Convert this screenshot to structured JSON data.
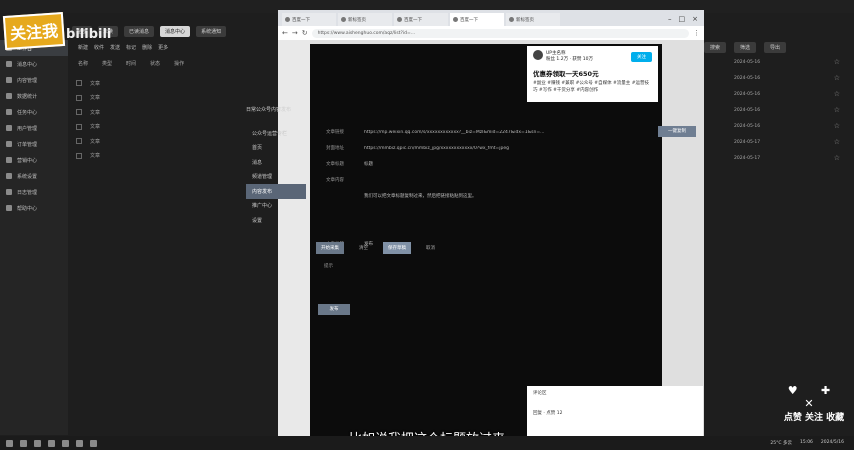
{
  "watermark": {
    "main": "关注我",
    "sub": "bilibili"
  },
  "top_buttons": [
    "全部",
    "未读",
    "已读消息",
    "消息中心",
    "系统通知"
  ],
  "toolbar": [
    "新建",
    "收件",
    "发送",
    "标记",
    "删除",
    "更多"
  ],
  "filters": [
    "名称",
    "类型",
    "时间",
    "状态",
    "操作"
  ],
  "list_rows": [
    "文章",
    "文章",
    "文章",
    "文章",
    "文章",
    "文章"
  ],
  "sidebar": [
    {
      "label": "工作台"
    },
    {
      "label": "消息中心"
    },
    {
      "label": "内容管理"
    },
    {
      "label": "数据统计"
    },
    {
      "label": "任务中心"
    },
    {
      "label": "用户管理"
    },
    {
      "label": "订单管理"
    },
    {
      "label": "营销中心"
    },
    {
      "label": "系统设置"
    },
    {
      "label": "日志管理"
    },
    {
      "label": "帮助中心"
    }
  ],
  "right_panel": {
    "buttons": [
      "搜索",
      "筛选",
      "导出"
    ],
    "rows": [
      "2024-05-16",
      "2024-05-16",
      "2024-05-16",
      "2024-05-16",
      "2024-05-16",
      "2024-05-17",
      "2024-05-17"
    ]
  },
  "browser": {
    "tabs": [
      "百度一下",
      "新标签页",
      "百度一下",
      "百度一下",
      "新标签页"
    ],
    "url": "https://www.aishenghuo.com/aqz/list?id=..."
  },
  "site": {
    "title": "日常公众号内容发布",
    "nav": [
      "公众号运营专栏",
      "首页",
      "消息",
      "频道管理",
      "内容发布",
      "推广中心",
      "设置"
    ],
    "active_nav": 4
  },
  "form": {
    "rows": [
      {
        "label": "文章链接",
        "value": "https://mp.weixin.qq.com/s/xxxxxxxxxxxx?__biz=MzI&mid=2247&idx=1&sn=..."
      },
      {
        "label": "封面地址",
        "value": "https://mmbiz.qpic.cn/mmbiz_jpg/xxxxxxxxxxxx/0?wx_fmt=jpeg"
      },
      {
        "label": "文章标题",
        "value": "标题"
      },
      {
        "label": "文章内容",
        "value": ""
      },
      {
        "label": "",
        "value": "我们可以把文章标题复制过来，然后把链接粘贴到这里。"
      },
      {
        "label": "",
        "value": ""
      },
      {
        "label": "",
        "value": ""
      },
      {
        "label": "文章标签",
        "value": "发布"
      }
    ],
    "copy_button": "一键复制",
    "buttons": {
      "primary": "开始采集",
      "plain": "清空",
      "secondary": "保存草稿",
      "plain2": "取消"
    },
    "small_text": "提示",
    "publish_button": "发布"
  },
  "card": {
    "name": "UP主名称",
    "meta": "粉丝 1.2万 · 获赞 10万",
    "follow": "关注",
    "headline": "优惠券领取一天650元",
    "tags": "#副业 #赚钱 #兼职 #公众号 #自媒体 #流量主 #运营技巧 #写作 #干货分享 #内容创作"
  },
  "card2": {
    "line1": "评论区",
    "line2": "回复 · 点赞 12"
  },
  "sticker": {
    "icons": "♥ ✚ ✕",
    "text": "点赞 关注 收藏"
  },
  "subtitle": "比如说我把这个标题放过来",
  "tray": {
    "weather": "25°C 多云",
    "time": "15:06",
    "date": "2024/5/16"
  }
}
